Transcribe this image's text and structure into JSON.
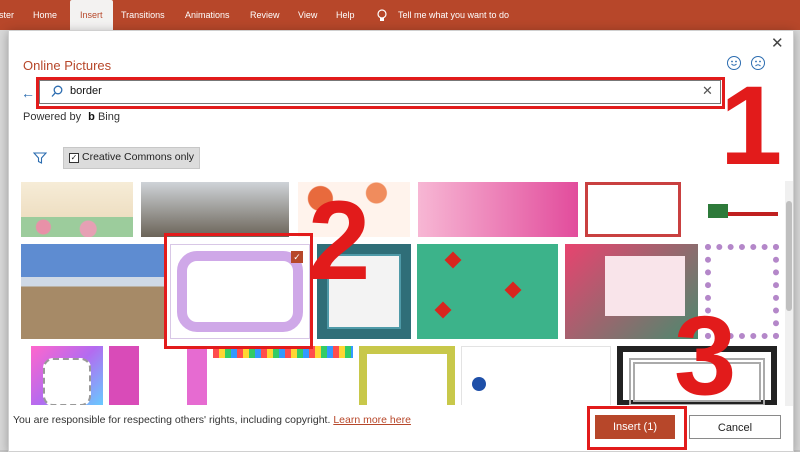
{
  "ribbon": {
    "tabs": [
      "ster",
      "Home",
      "Insert",
      "Transitions",
      "Animations",
      "Review",
      "View",
      "Help"
    ],
    "tell_me": "Tell me what you want to do"
  },
  "dialog": {
    "title": "Online Pictures",
    "search_value": "border",
    "powered_by": "Powered by",
    "bing": "Bing",
    "filter_label": "Creative Commons only",
    "footer_text": "You are responsible for respecting others' rights, including copyright.",
    "learn_more": "Learn more here",
    "insert_label": "Insert (1)",
    "cancel_label": "Cancel"
  },
  "annotations": [
    "1",
    "2",
    "3"
  ],
  "colors": {
    "accent": "#b7472a",
    "annotation": "#e21b1b",
    "icon_blue": "#2b6cb0"
  }
}
